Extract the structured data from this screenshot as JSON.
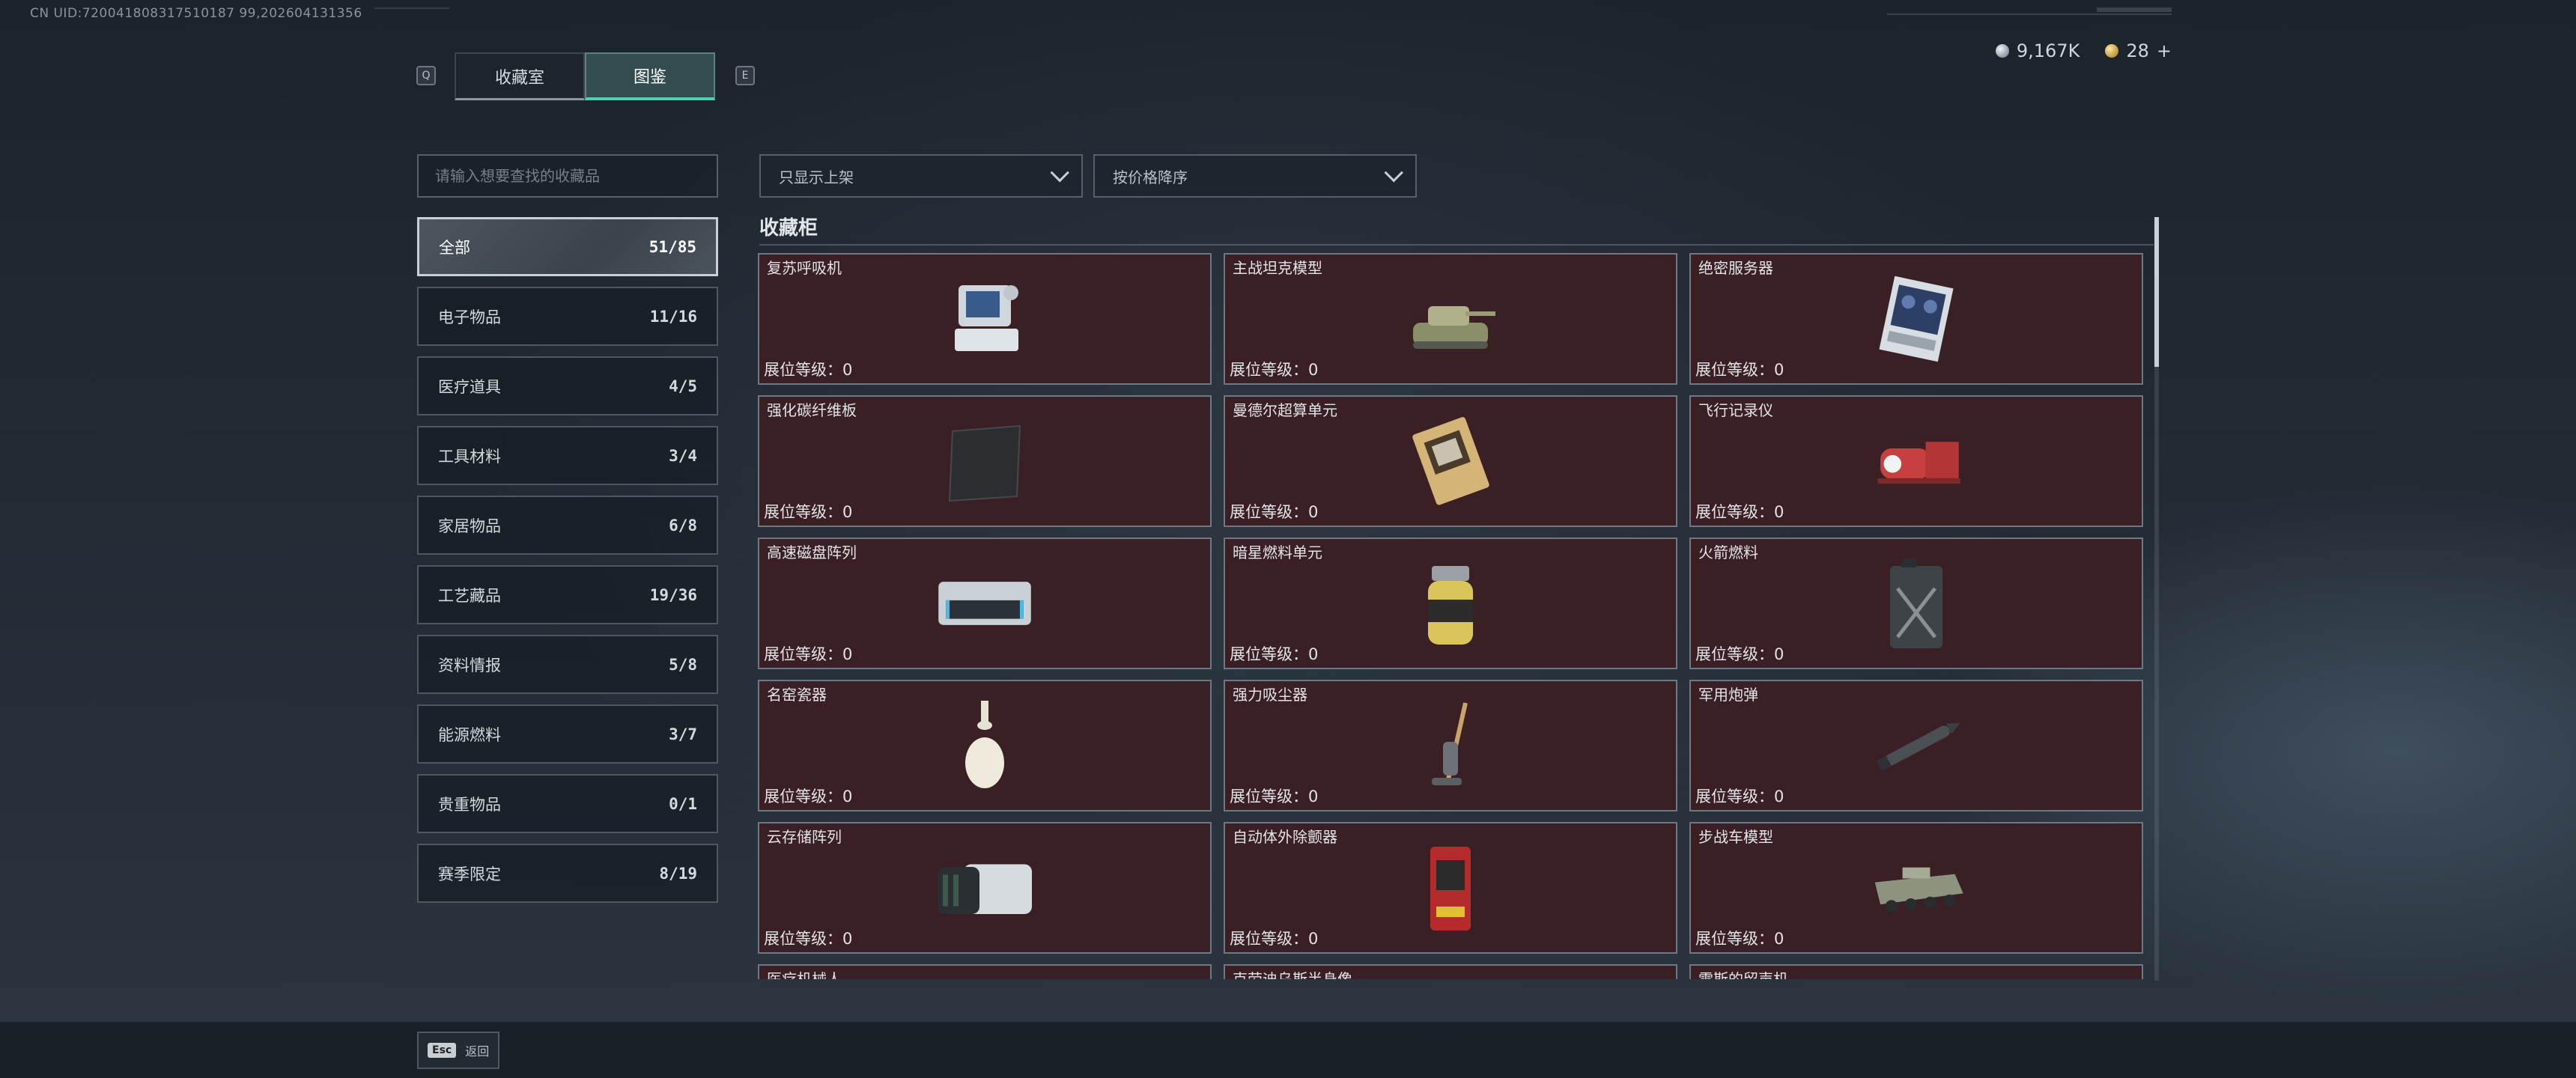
{
  "uid_text": "CN UID:720041808317510187 99,202604131356",
  "tabs": {
    "left_key": "Q",
    "right_key": "E",
    "items": [
      {
        "label": "收藏室"
      },
      {
        "label": "图鉴"
      }
    ]
  },
  "currency": {
    "silver": "9,167K",
    "gold": "28",
    "plus": "+"
  },
  "search": {
    "placeholder": "请输入想要查找的收藏品"
  },
  "filters": {
    "shelf": "只显示上架",
    "sort": "按价格降序"
  },
  "categories": [
    {
      "label": "全部",
      "count": "51/85"
    },
    {
      "label": "电子物品",
      "count": "11/16"
    },
    {
      "label": "医疗道具",
      "count": "4/5"
    },
    {
      "label": "工具材料",
      "count": "3/4"
    },
    {
      "label": "家居物品",
      "count": "6/8"
    },
    {
      "label": "工艺藏品",
      "count": "19/36"
    },
    {
      "label": "资料情报",
      "count": "5/8"
    },
    {
      "label": "能源燃料",
      "count": "3/7"
    },
    {
      "label": "贵重物品",
      "count": "0/1"
    },
    {
      "label": "赛季限定",
      "count": "8/19"
    }
  ],
  "section": {
    "title": "收藏柜"
  },
  "items": [
    {
      "name": "复苏呼吸机",
      "level": "展位等级：0",
      "icon": "ventilator-icon"
    },
    {
      "name": "主战坦克模型",
      "level": "展位等级：0",
      "icon": "tank-model-icon"
    },
    {
      "name": "绝密服务器",
      "level": "展位等级：0",
      "icon": "server-icon"
    },
    {
      "name": "强化碳纤维板",
      "level": "展位等级：0",
      "icon": "carbon-plate-icon"
    },
    {
      "name": "曼德尔超算单元",
      "level": "展位等级：0",
      "icon": "supercomputer-unit-icon"
    },
    {
      "name": "飞行记录仪",
      "level": "展位等级：0",
      "icon": "flight-recorder-icon"
    },
    {
      "name": "高速磁盘阵列",
      "level": "展位等级：0",
      "icon": "disk-array-icon"
    },
    {
      "name": "暗星燃料单元",
      "level": "展位等级：0",
      "icon": "fuel-cell-icon"
    },
    {
      "name": "火箭燃料",
      "level": "展位等级：0",
      "icon": "jerrycan-icon"
    },
    {
      "name": "名窑瓷器",
      "level": "展位等级：0",
      "icon": "porcelain-vase-icon"
    },
    {
      "name": "强力吸尘器",
      "level": "展位等级：0",
      "icon": "vacuum-cleaner-icon"
    },
    {
      "name": "军用炮弹",
      "level": "展位等级：0",
      "icon": "artillery-shell-icon"
    },
    {
      "name": "云存储阵列",
      "level": "展位等级：0",
      "icon": "cloud-storage-icon"
    },
    {
      "name": "自动体外除颤器",
      "level": "展位等级：0",
      "icon": "defibrillator-icon"
    },
    {
      "name": "步战车模型",
      "level": "展位等级：0",
      "icon": "ifv-model-icon"
    },
    {
      "name": "医疗机械人",
      "level": "",
      "icon": "medical-robot-icon"
    },
    {
      "name": "克劳迪乌斯半身像",
      "level": "",
      "icon": "bust-icon"
    },
    {
      "name": "雷斯的留声机",
      "level": "",
      "icon": "gramophone-icon"
    }
  ],
  "footer": {
    "esc_key": "Esc",
    "back_label": "返回"
  },
  "colors": {
    "accent": "#4fd0b0",
    "card_bg": "#3a1f24"
  }
}
